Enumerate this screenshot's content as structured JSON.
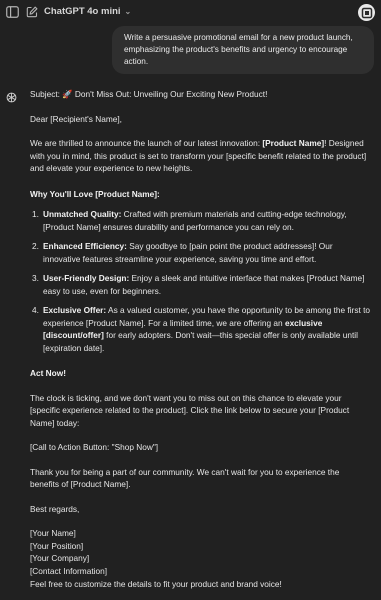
{
  "header": {
    "model_name": "ChatGPT 4o mini",
    "icons": [
      "sidebar-toggle-icon",
      "new-chat-icon",
      "chevron-down-icon",
      "profile-avatar"
    ]
  },
  "user_message": "Write a persuasive promotional email for a new product launch, emphasizing the product's benefits and urgency to encourage action.",
  "assistant": {
    "subject": "Subject: 🚀 Don't Miss Out: Unveiling Our Exciting New Product!",
    "greeting": "Dear [Recipient's Name],",
    "intro_1": "We are thrilled to announce the launch of our latest innovation: ",
    "intro_product": "[Product Name]",
    "intro_2": "! Designed with you in mind, this product is set to transform your [specific benefit related to the product] and elevate your experience to new heights.",
    "why_heading": "Why You'll Love [Product Name]:",
    "benefits": [
      {
        "num": "1.",
        "title": "Unmatched Quality:",
        "text": " Crafted with premium materials and cutting-edge technology, [Product Name] ensures durability and performance you can rely on."
      },
      {
        "num": "2.",
        "title": "Enhanced Efficiency:",
        "text": " Say goodbye to [pain point the product addresses]! Our innovative features streamline your experience, saving you time and effort."
      },
      {
        "num": "3.",
        "title": "User-Friendly Design:",
        "text": " Enjoy a sleek and intuitive interface that makes [Product Name] easy to use, even for beginners."
      },
      {
        "num": "4.",
        "title": "Exclusive Offer:",
        "text_1": " As a valued customer, you have the opportunity to be among the first to experience [Product Name]. For a limited time, we are offering an ",
        "bold": "exclusive [discount/offer]",
        "text_2": " for early adopters. Don't wait—this special offer is only available until [expiration date]."
      }
    ],
    "act_now": "Act Now!",
    "clock_para": "The clock is ticking, and we don't want you to miss out on this chance to elevate your [specific experience related to the product]. Click the link below to secure your [Product Name] today:",
    "cta": "[Call to Action Button: \"Shop Now\"]",
    "thanks": "Thank you for being a part of our community. We can't wait for you to experience the benefits of [Product Name].",
    "regards": "Best regards,",
    "signature": [
      "[Your Name]",
      "[Your Position]",
      "[Your Company]",
      "[Contact Information]"
    ],
    "closing_note": "Feel free to customize the details to fit your product and brand voice!"
  }
}
